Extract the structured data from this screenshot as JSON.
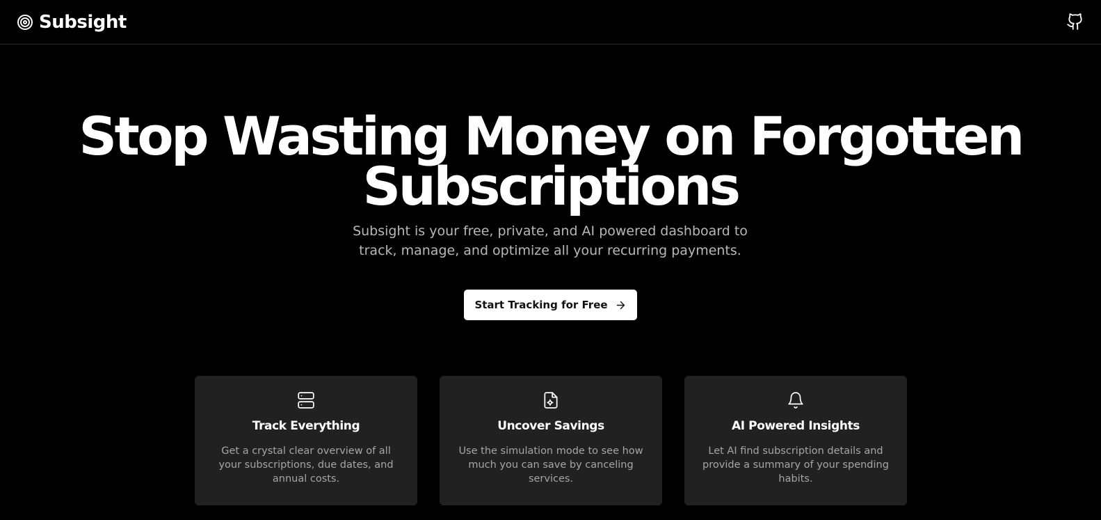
{
  "brand": {
    "name": "Subsight",
    "icon": "target-icon"
  },
  "header": {
    "github_icon": "github-icon"
  },
  "hero": {
    "title": "Stop Wasting Money on Forgotten Subscriptions",
    "subtitle": "Subsight is your free, private, and AI powered dashboard to track, manage, and optimize all your recurring payments.",
    "cta_label": "Start Tracking for Free",
    "cta_icon": "arrow-right-icon"
  },
  "features": [
    {
      "icon": "server-icon",
      "title": "Track Everything",
      "description": "Get a crystal clear overview of all your subscriptions, due dates, and annual costs."
    },
    {
      "icon": "file-cog-icon",
      "title": "Uncover Savings",
      "description": "Use the simulation mode to see how much you can save by canceling services."
    },
    {
      "icon": "bell-icon",
      "title": "AI Powered Insights",
      "description": "Let AI find subscription details and provide a summary of your spending habits."
    }
  ],
  "colors": {
    "background": "#000000",
    "card_background": "#212121",
    "text_primary": "#ffffff",
    "text_muted": "#a6a6a6",
    "cta_background": "#ffffff",
    "cta_text": "#111111"
  }
}
